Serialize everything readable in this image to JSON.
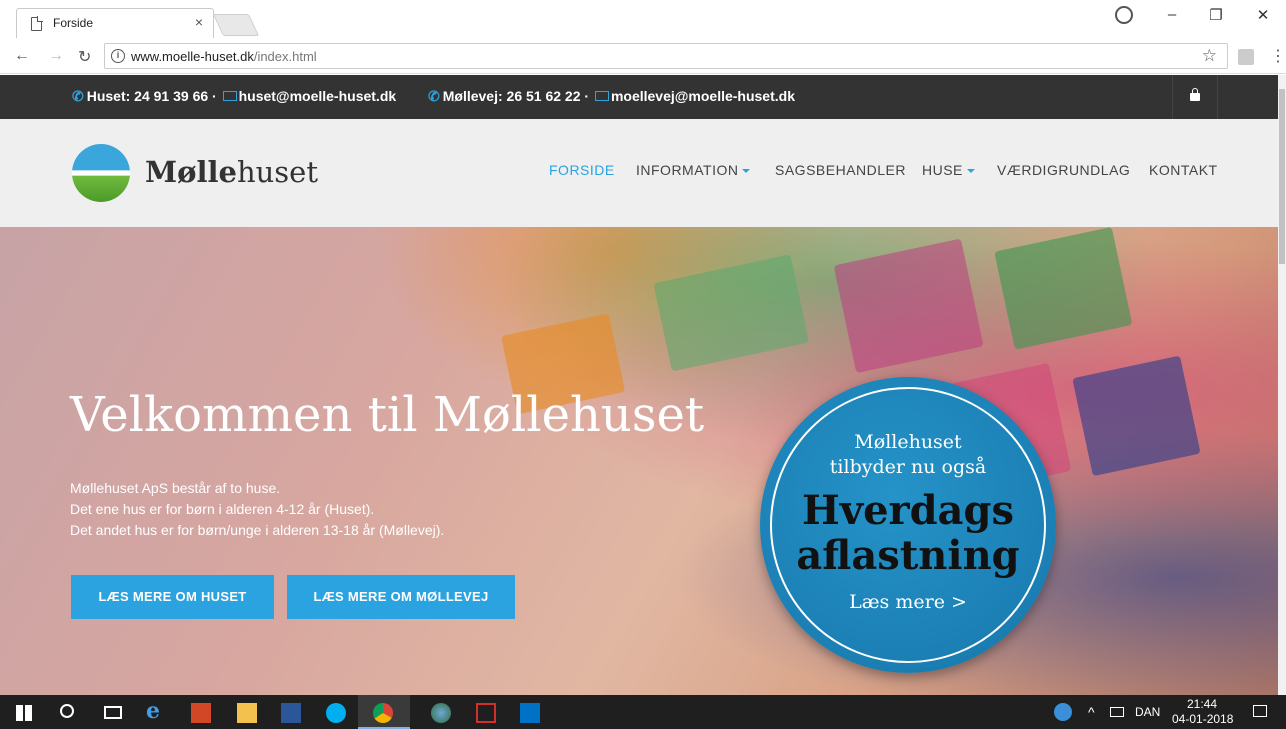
{
  "browser": {
    "tab_title": "Forside",
    "tab_close": "×",
    "url_domain": "www.moelle-huset.dk",
    "url_path": "/index.html",
    "window_min": "–",
    "window_max": "❐",
    "window_close": "✕"
  },
  "topbar": {
    "contact1": "Huset: 24 91 39 66 · ",
    "email1": "huset@moelle-huset.dk",
    "contact2": "Møllevej: 26 51 62 22 · ",
    "email2": "moellevej@moelle-huset.dk"
  },
  "header": {
    "logo_bold": "Mølle",
    "logo_rest": "huset",
    "nav": [
      "FORSIDE",
      "INFORMATION",
      "SAGSBEHANDLER",
      "HUSE",
      "VÆRDIGRUNDLAG",
      "KONTAKT"
    ]
  },
  "hero": {
    "title": "Velkommen til Møllehuset",
    "lines": [
      "Møllehuset ApS består af to huse.",
      "Det ene hus er for børn i alderen 4-12 år (Huset).",
      "Det andet hus er for børn/unge i alderen 13-18 år (Møllevej)."
    ],
    "button1": "LÆS MERE OM HUSET",
    "button2": "LÆS MERE OM MØLLEVEJ"
  },
  "badge": {
    "line1": "Møllehuset",
    "line2": "tilbyder nu også",
    "big1": "Hverdags",
    "big2": "aflastning",
    "more": "Læs mere >"
  },
  "taskbar": {
    "lang": "DAN",
    "time": "21:44",
    "date": "04-01-2018"
  },
  "colors": {
    "accent": "#2aa3e0",
    "topbar": "#333333",
    "header": "#efefef",
    "badge": "#1b7fb4"
  }
}
